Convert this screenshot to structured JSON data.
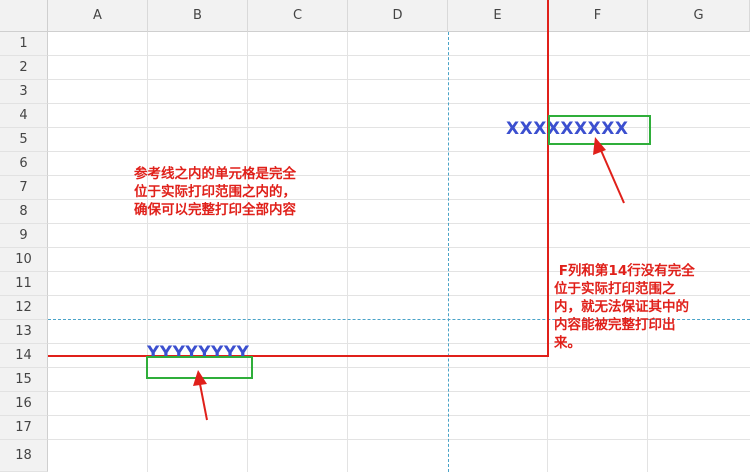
{
  "columns": [
    "A",
    "B",
    "C",
    "D",
    "E",
    "F",
    "G"
  ],
  "rows": [
    "1",
    "2",
    "3",
    "4",
    "5",
    "6",
    "7",
    "8",
    "9",
    "10",
    "11",
    "12",
    "13",
    "14",
    "15",
    "16",
    "17",
    "18"
  ],
  "cells": {
    "f5_value": "XXXXXXXXX",
    "b14_value": "YYYYYYYY"
  },
  "notes": {
    "left": "参考线之内的单元格是完全\n位于实际打印范围之内的，\n确保可以完整打印全部内容",
    "right": " F列和第14行没有完全\n位于实际打印范围之\n内，就无法保证其中的\n内容能被完整打印出\n来。"
  },
  "colors": {
    "print_boundary": "#e0201a",
    "page_break_guide": "#4aa3c8",
    "highlight_box": "#2fae3a",
    "cell_text": "#3b4fcf",
    "annotation_text": "#e0201a"
  }
}
